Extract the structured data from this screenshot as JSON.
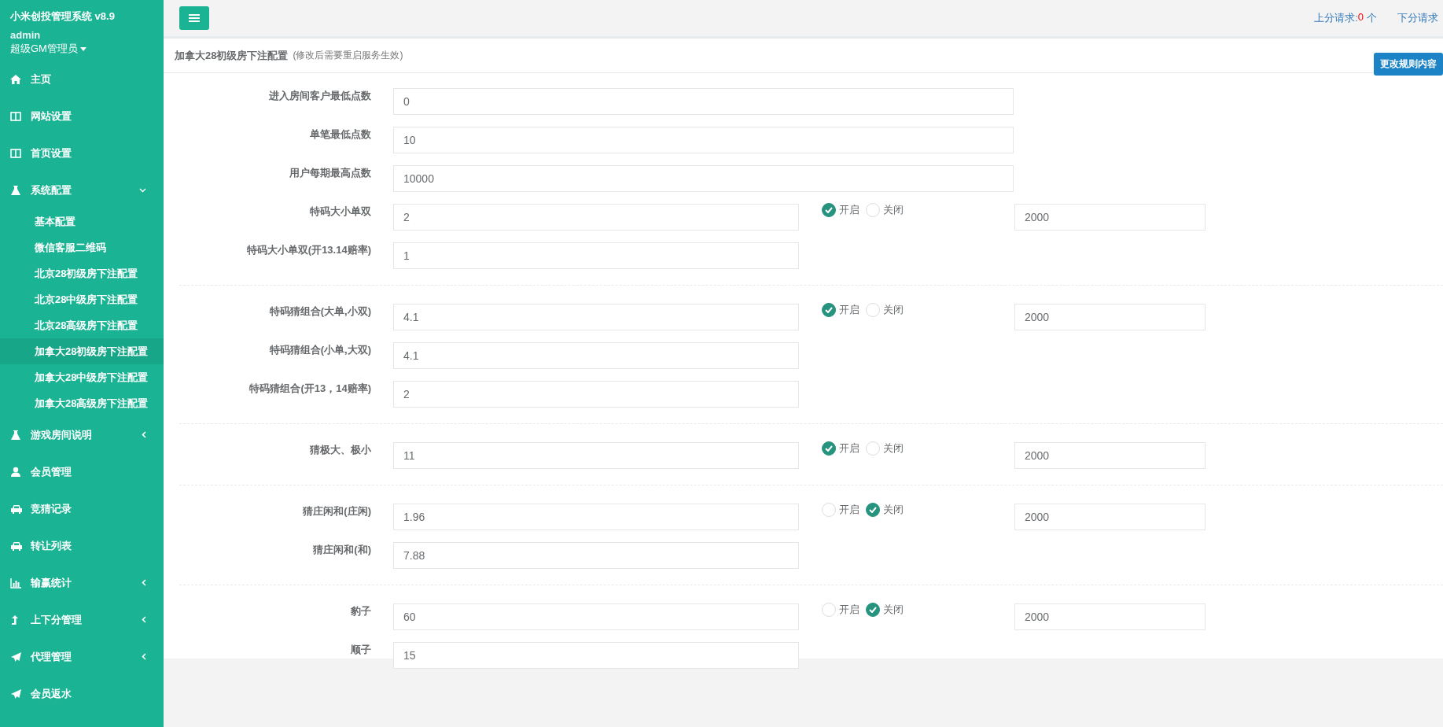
{
  "sidebar": {
    "app_title": "小米创投管理系统 v8.9",
    "user": "admin",
    "role": "超级GM管理员",
    "items": [
      {
        "kind": "home",
        "label": "主页"
      },
      {
        "kind": "columns",
        "label": "网站设置"
      },
      {
        "kind": "columns",
        "label": "首页设置"
      },
      {
        "kind": "flask",
        "label": "系统配置",
        "expanded": true,
        "children": [
          {
            "label": "基本配置",
            "selected": false
          },
          {
            "label": "微信客服二维码",
            "selected": false
          },
          {
            "label": "北京28初级房下注配置",
            "selected": false
          },
          {
            "label": "北京28中级房下注配置",
            "selected": false
          },
          {
            "label": "北京28高级房下注配置",
            "selected": false
          },
          {
            "label": "加拿大28初级房下注配置",
            "selected": true
          },
          {
            "label": "加拿大28中级房下注配置",
            "selected": false
          },
          {
            "label": "加拿大28高级房下注配置",
            "selected": false
          }
        ]
      },
      {
        "kind": "flask",
        "label": "游戏房间说明",
        "expanded": false
      },
      {
        "kind": "user",
        "label": "会员管理"
      },
      {
        "kind": "car",
        "label": "竞猜记录"
      },
      {
        "kind": "car",
        "label": "转让列表"
      },
      {
        "kind": "chart",
        "label": "输赢统计",
        "expanded": false
      },
      {
        "kind": "arrow",
        "label": "上下分管理",
        "expanded": false
      },
      {
        "kind": "plane",
        "label": "代理管理",
        "expanded": false
      },
      {
        "kind": "plane",
        "label": "会员返水"
      }
    ]
  },
  "topbar": {
    "requests": [
      {
        "label": "上分请求:",
        "count": "0",
        "unit": "个"
      },
      {
        "label": "下分请求"
      }
    ]
  },
  "panel": {
    "title": "加拿大28初级房下注配置",
    "note": "(修改后需要重启服务生效)",
    "button": "更改规则内容",
    "groups": [
      {
        "rows": [
          {
            "kind": "wide",
            "label": "进入房间客户最低点数",
            "value": "0"
          },
          {
            "kind": "wide",
            "label": "单笔最低点数",
            "value": "10"
          },
          {
            "kind": "wide",
            "label": "用户每期最高点数",
            "value": "10000"
          },
          {
            "kind": "narrow",
            "label": "特码大小单双",
            "value": "2",
            "switch": [
              {
                "label": "开启",
                "selected": true
              },
              {
                "label": "关闭",
                "selected": false
              }
            ],
            "limit": "2000"
          },
          {
            "kind": "narrow",
            "label": "特码大小单双(开13.14赔率)",
            "value": "1"
          }
        ]
      },
      {
        "rows": [
          {
            "kind": "narrow",
            "label": "特码猜组合(大单,小双)",
            "value": "4.1",
            "switch": [
              {
                "label": "开启",
                "selected": true
              },
              {
                "label": "关闭",
                "selected": false
              }
            ],
            "limit": "2000"
          },
          {
            "kind": "narrow",
            "label": "特码猜组合(小单,大双)",
            "value": "4.1"
          },
          {
            "kind": "narrow",
            "label": "特码猜组合(开13，14赔率)",
            "value": "2"
          }
        ]
      },
      {
        "rows": [
          {
            "kind": "narrow",
            "label": "猜极大、极小",
            "value": "11",
            "switch": [
              {
                "label": "开启",
                "selected": true
              },
              {
                "label": "关闭",
                "selected": false
              }
            ],
            "limit": "2000"
          }
        ]
      },
      {
        "rows": [
          {
            "kind": "narrow",
            "label": "猜庄闲和(庄闲)",
            "value": "1.96",
            "switch": [
              {
                "label": "开启",
                "selected": false
              },
              {
                "label": "关闭",
                "selected": true
              }
            ],
            "limit": "2000"
          },
          {
            "kind": "narrow",
            "label": "猜庄闲和(和)",
            "value": "7.88"
          }
        ]
      },
      {
        "rows": [
          {
            "kind": "narrow",
            "label": "豹子",
            "value": "60",
            "switch": [
              {
                "label": "开启",
                "selected": false
              },
              {
                "label": "关闭",
                "selected": true
              }
            ],
            "limit": "2000"
          },
          {
            "kind": "narrow",
            "label": "顺子",
            "value": "15"
          }
        ]
      }
    ]
  }
}
